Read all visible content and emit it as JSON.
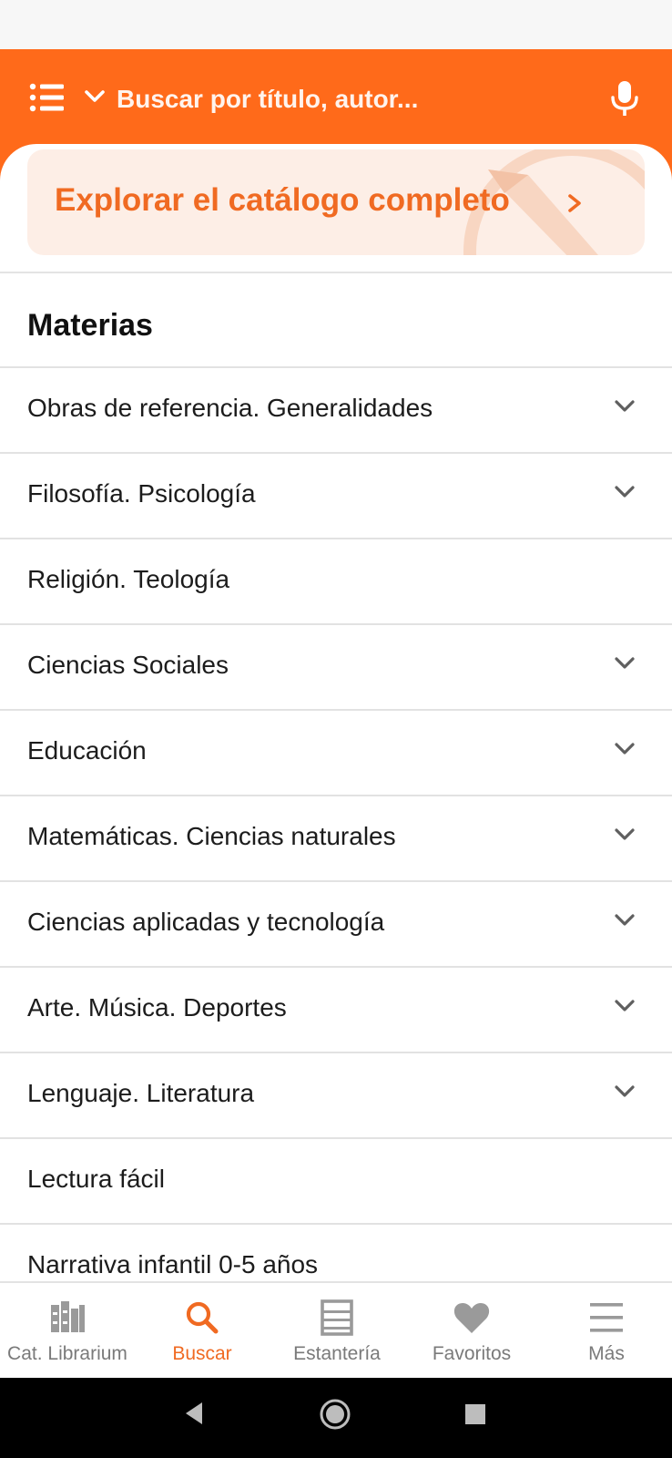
{
  "search": {
    "placeholder": "Buscar por título, autor..."
  },
  "explore": {
    "label": "Explorar el catálogo completo"
  },
  "section": {
    "title": "Materias"
  },
  "subjects": [
    {
      "label": "Obras de referencia. Generalidades",
      "expandable": true
    },
    {
      "label": "Filosofía. Psicología",
      "expandable": true
    },
    {
      "label": "Religión. Teología",
      "expandable": false
    },
    {
      "label": "Ciencias Sociales",
      "expandable": true
    },
    {
      "label": "Educación",
      "expandable": true
    },
    {
      "label": "Matemáticas. Ciencias naturales",
      "expandable": true
    },
    {
      "label": "Ciencias aplicadas y tecnología",
      "expandable": true
    },
    {
      "label": "Arte. Música. Deportes",
      "expandable": true
    },
    {
      "label": "Lenguaje. Literatura",
      "expandable": true
    },
    {
      "label": "Lectura fácil",
      "expandable": false
    },
    {
      "label": "Narrativa infantil 0-5 años",
      "expandable": false
    }
  ],
  "nav": {
    "catalog": {
      "label": "Cat. Librarium",
      "icon": "catalog-icon"
    },
    "search": {
      "label": "Buscar",
      "icon": "search-icon",
      "active": true
    },
    "shelf": {
      "label": "Estantería",
      "icon": "shelf-icon"
    },
    "favorites": {
      "label": "Favoritos",
      "icon": "heart-icon"
    },
    "more": {
      "label": "Más",
      "icon": "hamburger-icon"
    }
  },
  "colors": {
    "accent": "#ff6a1a",
    "accent_text": "#f06a22",
    "card_bg": "#fdeee6",
    "nav_inactive": "#7a7a7a"
  }
}
